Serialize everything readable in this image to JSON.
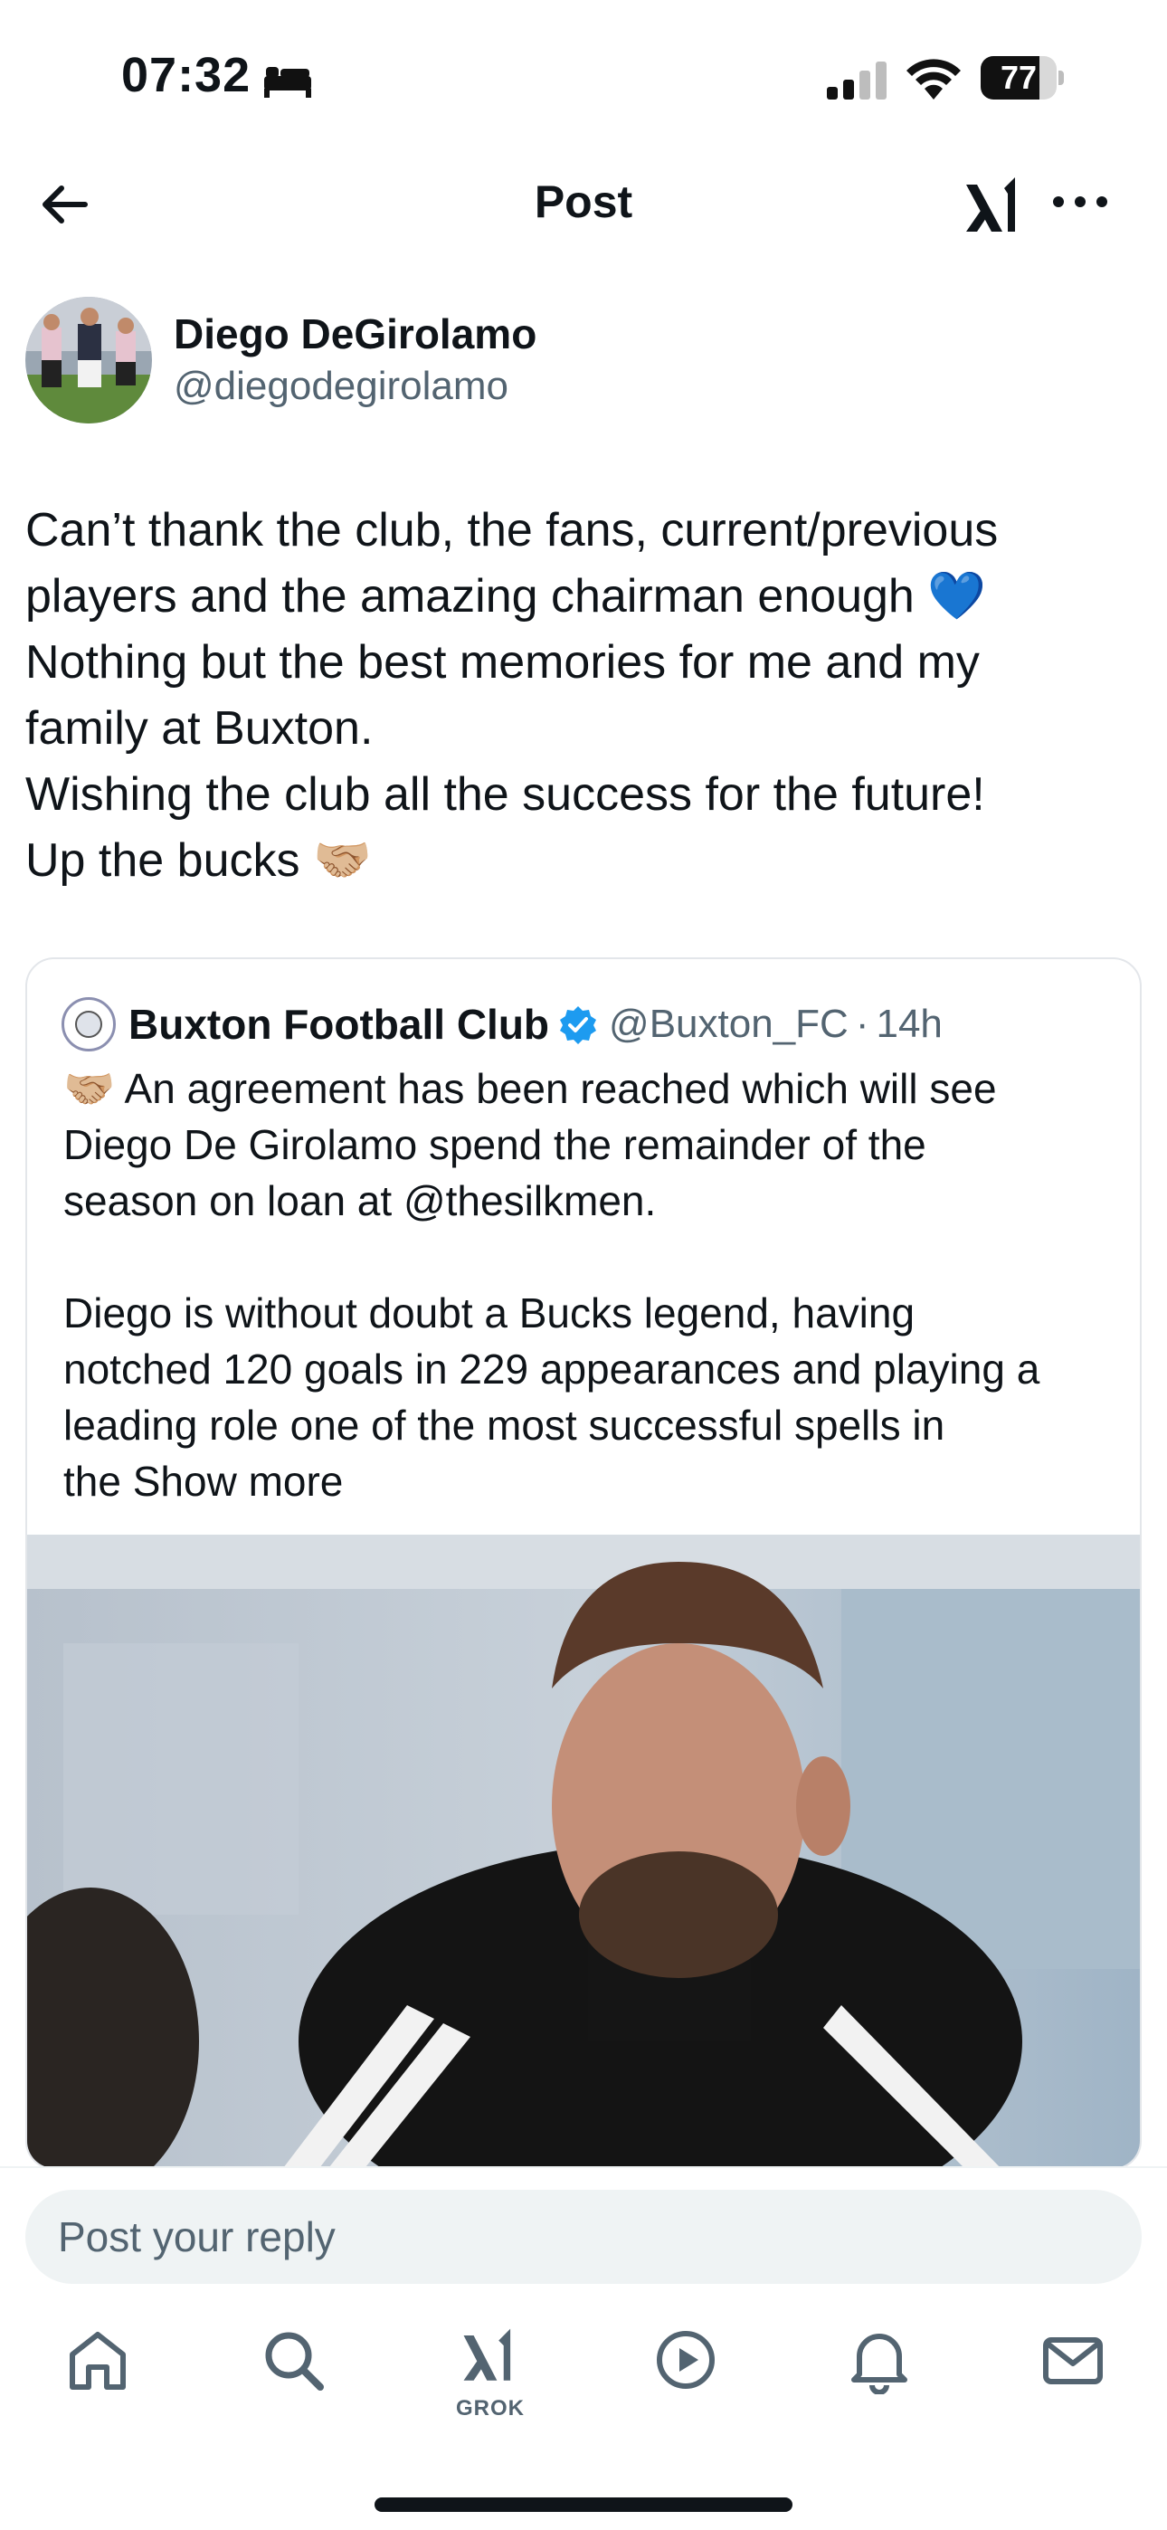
{
  "status_bar": {
    "time": "07:32",
    "battery_level": "77",
    "battery_fraction": 0.77
  },
  "header": {
    "title": "Post"
  },
  "post": {
    "author_name": "Diego DeGirolamo",
    "author_handle": "@diegodegirolamo",
    "text_lines": [
      "Can’t thank the club, the fans, current/previous",
      "players and the amazing chairman enough 💙",
      "Nothing but the best memories for me and my",
      "family at Buxton.",
      "Wishing the club all the success for the future!",
      "Up the bucks 🤝🏼"
    ]
  },
  "quote": {
    "name": "Buxton Football Club",
    "handle": "@Buxton_FC",
    "separator": "·",
    "time": "14h",
    "text_lines": [
      "🤝🏼 An agreement has been reached which will see",
      "Diego De Girolamo spend the remainder of the",
      "season on loan at @thesilkmen.",
      "",
      "Diego is without doubt a Bucks legend, having",
      "notched 120 goals in 229 appearances and playing a",
      "leading role one of the most successful spells in"
    ],
    "last_line_prefix": "the",
    "show_more": "Show more"
  },
  "reply": {
    "placeholder": "Post your reply"
  },
  "tabbar": {
    "grok_label": "GROK"
  },
  "colors": {
    "accent_blue": "#1d9bf0",
    "secondary_text": "#536471",
    "heart_blue": "#2f80ed"
  },
  "icons": [
    "bed-icon",
    "signal-icon",
    "wifi-icon",
    "back-arrow-icon",
    "xai-logo-icon",
    "more-icon",
    "verified-icon",
    "home-icon",
    "search-icon",
    "grok-icon",
    "video-icon",
    "notifications-icon",
    "messages-icon"
  ]
}
